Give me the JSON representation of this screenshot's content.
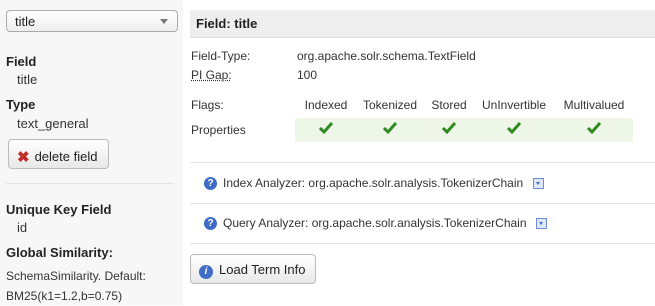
{
  "sidebar": {
    "selected_field": "title",
    "field_heading": "Field",
    "field_value": "title",
    "type_heading": "Type",
    "type_value": "text_general",
    "delete_button": "delete field",
    "unique_key_heading": "Unique Key Field",
    "unique_key_value": "id",
    "similarity_heading": "Global Similarity:",
    "similarity_value": "SchemaSimilarity. Default: BM25(k1=1.2,b=0.75)"
  },
  "main": {
    "title": "Field: title",
    "field_type_label": "Field-Type:",
    "field_type_value": "org.apache.solr.schema.TextField",
    "pi_gap_label": "PI Gap:",
    "pi_gap_value": "100",
    "flags_label": "Flags:",
    "flags": [
      "Indexed",
      "Tokenized",
      "Stored",
      "UnInvertible",
      "Multivalued"
    ],
    "properties_label": "Properties",
    "index_analyzer_label": "Index Analyzer:",
    "index_analyzer_value": "org.apache.solr.analysis.TokenizerChain",
    "query_analyzer_label": "Query Analyzer:",
    "query_analyzer_value": "org.apache.solr.analysis.TokenizerChain",
    "load_button": "Load Term Info"
  },
  "icons": {
    "check": "checkmark-icon",
    "delete": "x-icon",
    "help": "question-icon",
    "info": "info-icon",
    "accent": "#3e6dc7",
    "check_color": "#2e8b1e"
  }
}
